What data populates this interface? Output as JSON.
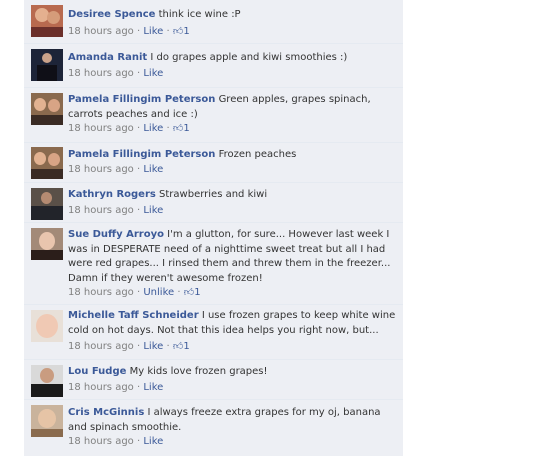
{
  "comments": [
    {
      "name": "Desiree Spence",
      "text": "think ice wine :P",
      "time": "18 hours ago",
      "action": "Like",
      "likes": "1"
    },
    {
      "name": "Amanda Ranit",
      "text": "I do grapes apple and kiwi smoothies :)",
      "time": "18 hours ago",
      "action": "Like",
      "likes": ""
    },
    {
      "name": "Pamela Fillingim Peterson",
      "text": "Green apples, grapes spinach, carrots peaches and ice :)",
      "time": "18 hours ago",
      "action": "Like",
      "likes": "1"
    },
    {
      "name": "Pamela Fillingim Peterson",
      "text": "Frozen peaches",
      "time": "18 hours ago",
      "action": "Like",
      "likes": ""
    },
    {
      "name": "Kathryn Rogers",
      "text": "Strawberries and kiwi",
      "time": "18 hours ago",
      "action": "Like",
      "likes": ""
    },
    {
      "name": "Sue Duffy Arroyo",
      "text": "I'm a glutton, for sure... However last week I was in DESPERATE need of a nighttime sweet treat but all I had were red grapes... I rinsed them and threw them in the freezer... Damn if they weren't awesome frozen!",
      "time": "18 hours ago",
      "action": "Unlike",
      "likes": "1"
    },
    {
      "name": "Michelle Taff Schneider",
      "text": "I use frozen grapes to keep white wine cold on hot days. Not that this idea helps you right now, but...",
      "time": "18 hours ago",
      "action": "Like",
      "likes": "1"
    },
    {
      "name": "Lou Fudge",
      "text": "My kids love frozen grapes!",
      "time": "18 hours ago",
      "action": "Like",
      "likes": ""
    },
    {
      "name": "Cris McGinnis",
      "text": "I always freeze extra grapes for my oj, banana and spinach smoothie.",
      "time": "18 hours ago",
      "action": "Like",
      "likes": ""
    }
  ],
  "separator": "·",
  "like_icon": "thumbs-up-icon"
}
